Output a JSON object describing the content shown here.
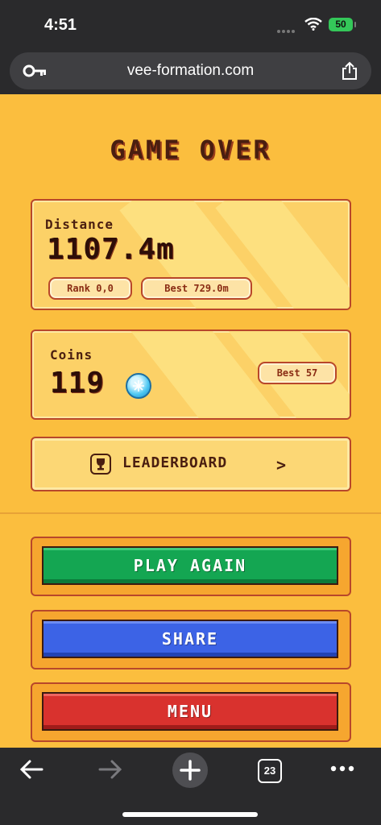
{
  "status_bar": {
    "time": "4:51",
    "battery": "50"
  },
  "browser": {
    "url": "vee-formation.com",
    "tabs_count": "23"
  },
  "game": {
    "title": "GAME OVER",
    "distance": {
      "label": "Distance",
      "value": "1107.4m",
      "rank": "Rank 0,0",
      "best": "Best 729.0m"
    },
    "coins": {
      "label": "Coins",
      "value": "119",
      "best": "Best 57"
    },
    "leaderboard_label": "LEADERBOARD",
    "leaderboard_chevron": ">",
    "buttons": {
      "play_again": "PLAY AGAIN",
      "share": "SHARE",
      "menu": "MENU"
    }
  },
  "colors": {
    "background": "#fbbe3e",
    "panel": "#fcd167",
    "border": "#b8472a",
    "play": "#14a652",
    "share": "#3c63e6",
    "menu": "#d9322e"
  },
  "icons": [
    "key-icon",
    "share-icon",
    "wifi-icon",
    "gem-icon",
    "trophy-icon",
    "back-icon",
    "forward-icon",
    "plus-icon",
    "tabs-icon",
    "more-icon"
  ]
}
